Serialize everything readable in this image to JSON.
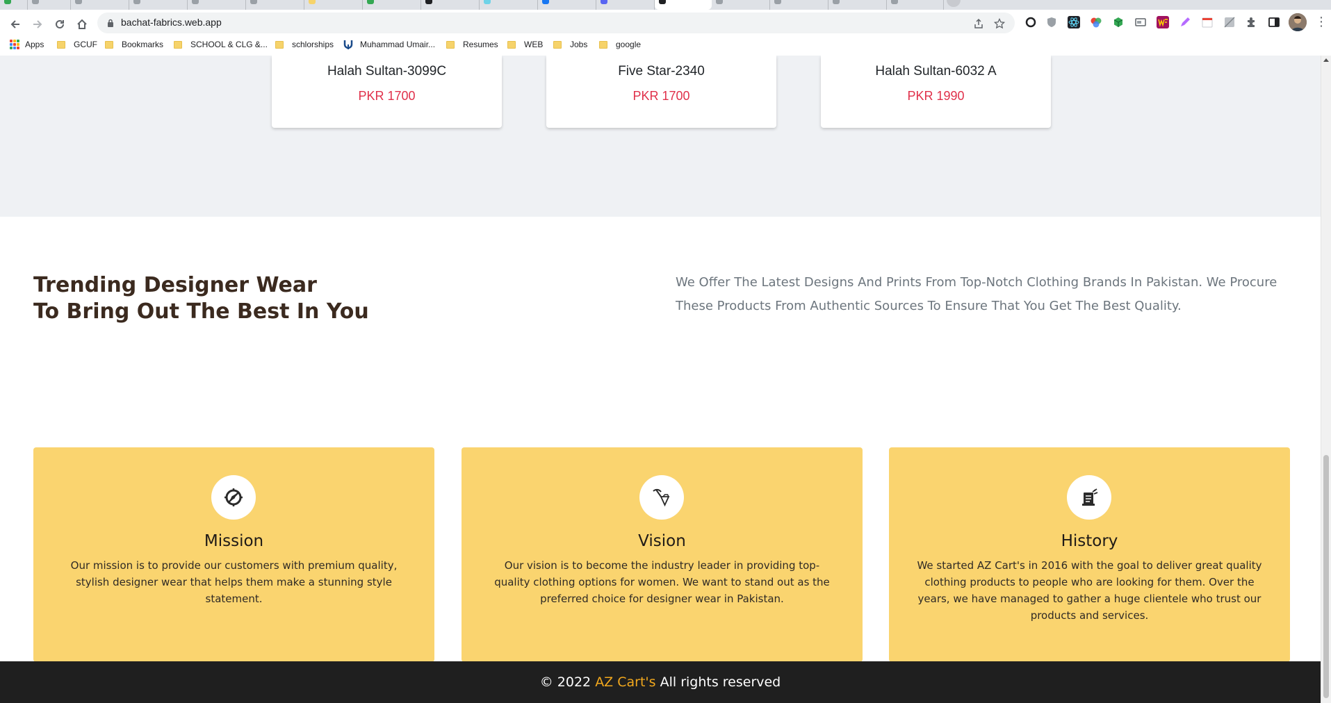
{
  "browser": {
    "url": "bachat-fabrics.web.app",
    "bookmarks": [
      {
        "label": "Apps",
        "type": "apps"
      },
      {
        "label": "GCUF",
        "type": "folder"
      },
      {
        "label": "Bookmarks",
        "type": "folder"
      },
      {
        "label": "SCHOOL & CLG &...",
        "type": "folder"
      },
      {
        "label": "schlorships",
        "type": "folder"
      },
      {
        "label": "Muhammad Umair...",
        "type": "link"
      },
      {
        "label": "Resumes",
        "type": "folder"
      },
      {
        "label": "WEB",
        "type": "folder"
      },
      {
        "label": "Jobs",
        "type": "folder"
      },
      {
        "label": "google",
        "type": "folder"
      }
    ],
    "icons": {
      "back": "back-arrow-icon",
      "forward": "forward-arrow-icon",
      "reload": "reload-icon",
      "home": "home-icon",
      "lock": "lock-icon",
      "share": "share-icon",
      "star": "bookmark-star-icon",
      "extensions": "puzzle-icon",
      "sidepanel": "side-panel-icon",
      "menu": "more-vertical-icon"
    }
  },
  "products": [
    {
      "name": "Halah Sultan-3099C",
      "price": "PKR 1700"
    },
    {
      "name": "Five Star-2340",
      "price": "PKR 1700"
    },
    {
      "name": "Halah Sultan-6032 A",
      "price": "PKR 1990"
    }
  ],
  "about": {
    "headline_line1": "Trending Designer Wear",
    "headline_line2": "To Bring Out The Best In You",
    "tagline": "We Offer The Latest Designs And Prints From Top-Notch Clothing Brands In Pakistan. We Procure These Products From Authentic Sources To Ensure That You Get The Best Quality."
  },
  "info_cards": [
    {
      "title": "Mission",
      "icon": "compass-icon",
      "text": "Our mission is to provide our customers with premium quality, stylish designer wear that helps them make a stunning style statement."
    },
    {
      "title": "Vision",
      "icon": "diamond-pickaxe-icon",
      "text": "Our vision is to become the industry leader in providing top-quality clothing options for women. We want to stand out as the preferred choice for designer wear in Pakistan."
    },
    {
      "title": "History",
      "icon": "scroll-document-icon",
      "text": "We started AZ Cart's in 2016 with the goal to deliver great quality clothing products to people who are looking for them. Over the years, we have managed to gather a huge clientele who trust our products and services."
    }
  ],
  "footer": {
    "prefix": "© 2022",
    "brand": "AZ Cart's",
    "suffix": "All rights reserved"
  },
  "colors": {
    "price": "#e0304a",
    "card_bg": "#fad46f",
    "heading": "#3b2a1f",
    "footer_bg": "#1f1f1f",
    "footer_brand": "#f2a81d"
  }
}
